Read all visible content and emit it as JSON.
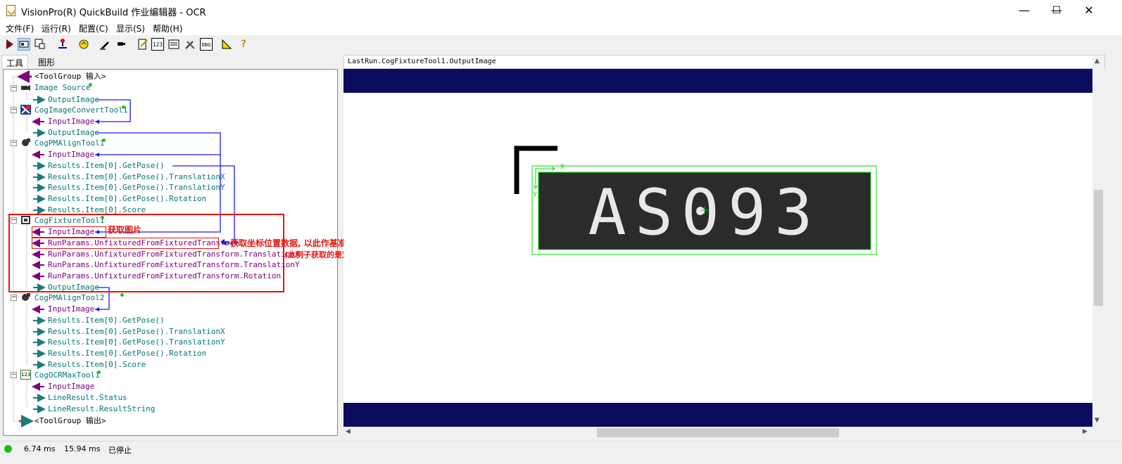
{
  "window": {
    "title": "VisionPro(R) QuickBuild 作业编辑器 - OCR"
  },
  "window_controls": {
    "minimize": "—",
    "maximize": "☐",
    "close": "✕"
  },
  "menu": [
    "文件(F)",
    "运行(R)",
    "配置(C)",
    "显示(S)",
    "帮助(H)"
  ],
  "toolbar": {
    "icons": [
      "run-icon",
      "image-view-icon",
      "image-select-icon",
      "load-icon",
      "refresh-icon",
      "pen-icon",
      "flag-icon",
      "edit-icon",
      "number-123-icon",
      "list-icon",
      "tools-icon",
      "dbg-icon",
      "ruler-icon",
      "help-icon"
    ],
    "labels": {
      "n123": "123",
      "dbg": "DBG",
      "help": "?"
    }
  },
  "tabs": [
    "工具",
    "图形"
  ],
  "tree": {
    "input_group": "<ToolGroup 输入>",
    "image_source": "Image Source",
    "image_source_output": "OutputImage",
    "convert_tool": "CogImageConvertTool1",
    "convert_input": "InputImage",
    "convert_output": "OutputImage",
    "pmalign1": "CogPMAlignTool1",
    "pmalign1_input": "InputImage",
    "pmalign1_results": [
      "Results.Item[0].GetPose()",
      "Results.Item[0].GetPose().TranslationX",
      "Results.Item[0].GetPose().TranslationY",
      "Results.Item[0].GetPose().Rotation",
      "Results.Item[0].Score"
    ],
    "fixture_tool": "CogFixtureTool1",
    "fixture_input": "InputImage",
    "fixture_params": [
      "RunParams.UnfixturedFromFixturedTransform",
      "RunParams.UnfixturedFromFixturedTransform.TranslationX",
      "RunParams.UnfixturedFromFixturedTransform.TranslationY",
      "RunParams.UnfixturedFromFixturedTransform.Rotation"
    ],
    "fixture_output": "OutputImage",
    "pmalign2": "CogPMAlignTool2",
    "pmalign2_input": "InputImage",
    "pmalign2_results": [
      "Results.Item[0].GetPose()",
      "Results.Item[0].GetPose().TranslationX",
      "Results.Item[0].GetPose().TranslationY",
      "Results.Item[0].GetPose().Rotation",
      "Results.Item[0].Score"
    ],
    "ocr_tool": "CogOCRMaxTool1",
    "ocr_input": "InputImage",
    "ocr_outputs": [
      "LineResult.Status",
      "LineResult.ResultString"
    ],
    "output_group": "<ToolGroup 输出>"
  },
  "annotations": {
    "get_image": "获取图片",
    "get_coords": "获取坐标位置数据, 以此作基准位置建立定位空间坐标系",
    "note": "(此例子获取的是定位工具模板匹配区的中心坐标)"
  },
  "image_panel": {
    "title": "LastRun.CogFixtureTool1.OutputImage",
    "ocr_text": "AS093",
    "axis_x": "X",
    "axis_y": "Y",
    "colors": {
      "band": "#0b0c5e",
      "graphic": "#00ff00",
      "plate": "#2b2b2b"
    }
  },
  "status": {
    "time1": "6.74 ms",
    "time2": "15.94 ms",
    "state": "已停止",
    "indicator_color": "#16c016"
  }
}
